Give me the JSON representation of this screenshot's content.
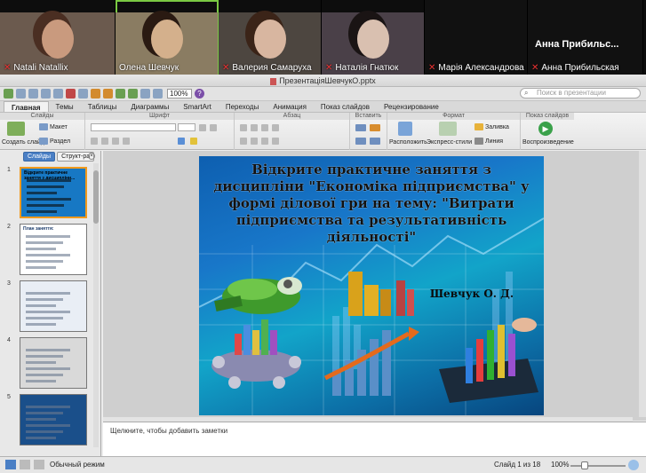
{
  "participants": [
    {
      "name": "Natali Natallix",
      "muted": true,
      "bg": "#6b5a4e",
      "face": "#c99a7e",
      "hair": "#4a2e22",
      "w": 130
    },
    {
      "name": "Олена Шевчук",
      "muted": false,
      "bg": "#8a7c62",
      "face": "#d4b08c",
      "hair": "#2a1a12",
      "w": 116
    },
    {
      "name": "Валерия Самаруха",
      "muted": true,
      "bg": "#4d4640",
      "face": "#d8b6a0",
      "hair": "#3b2418",
      "w": 116
    },
    {
      "name": "Наталія Гнатюк",
      "muted": true,
      "bg": "#4a4048",
      "face": "#d9c0b0",
      "hair": "#1a1414",
      "w": 116
    },
    {
      "name": "Марія Александрова",
      "muted": true,
      "bg": "#161616",
      "face": null,
      "hair": null,
      "w": 116
    },
    {
      "name": "Анна Прибильская",
      "muted": true,
      "bg": "#111111",
      "face": null,
      "hair": null,
      "w": 130,
      "big_name": "Анна Прибильс..."
    }
  ],
  "window": {
    "title": "ПрезентаціяШевчукО.pptx",
    "zoom": "100%",
    "search_placeholder": "Поиск в презентации"
  },
  "ribbon_tabs": [
    "Главная",
    "Темы",
    "Таблицы",
    "Диаграммы",
    "SmartArt",
    "Переходы",
    "Анимация",
    "Показ слайдов",
    "Рецензирование"
  ],
  "ribbon": {
    "group_slides": "Слайды",
    "group_font": "Шрифт",
    "group_paragraph": "Абзац",
    "group_insert": "Вставить",
    "group_format": "Формат",
    "group_slideshow": "Показ слайдов",
    "new_slide": "Создать слайд",
    "layout": "Макет",
    "section": "Раздел",
    "arrange": "Расположить",
    "quick_styles": "Экспресс-стили",
    "fill": "Заливка",
    "line": "Линия",
    "play": "Воспроизведение"
  },
  "panel": {
    "tab_slides": "Слайды",
    "tab_outline": "Структ-ра",
    "thumbs": [
      {
        "num": "1",
        "title": "Відкрите практичне заняття з дисципліни...",
        "bg": "#1778c4"
      },
      {
        "num": "2",
        "title": "План заняття:",
        "bg": "#ffffff"
      },
      {
        "num": "3",
        "title": "",
        "bg": "#e9eef5"
      },
      {
        "num": "4",
        "title": "",
        "bg": "#d9d9d9"
      },
      {
        "num": "5",
        "title": "",
        "bg": "#1a4f8a"
      }
    ]
  },
  "slide": {
    "title": "Відкрите практичне заняття з дисципліни \"Економіка підприємства\" у формі ділової гри на тему: \"Витрати підприємства та результативність діяльності\"",
    "author": "Шевчук О. Д."
  },
  "notes_placeholder": "Щелкните, чтобы добавить заметки",
  "status": {
    "view": "Обычный режим",
    "slide_counter": "Слайд 1 из 18",
    "zoom": "100%"
  }
}
